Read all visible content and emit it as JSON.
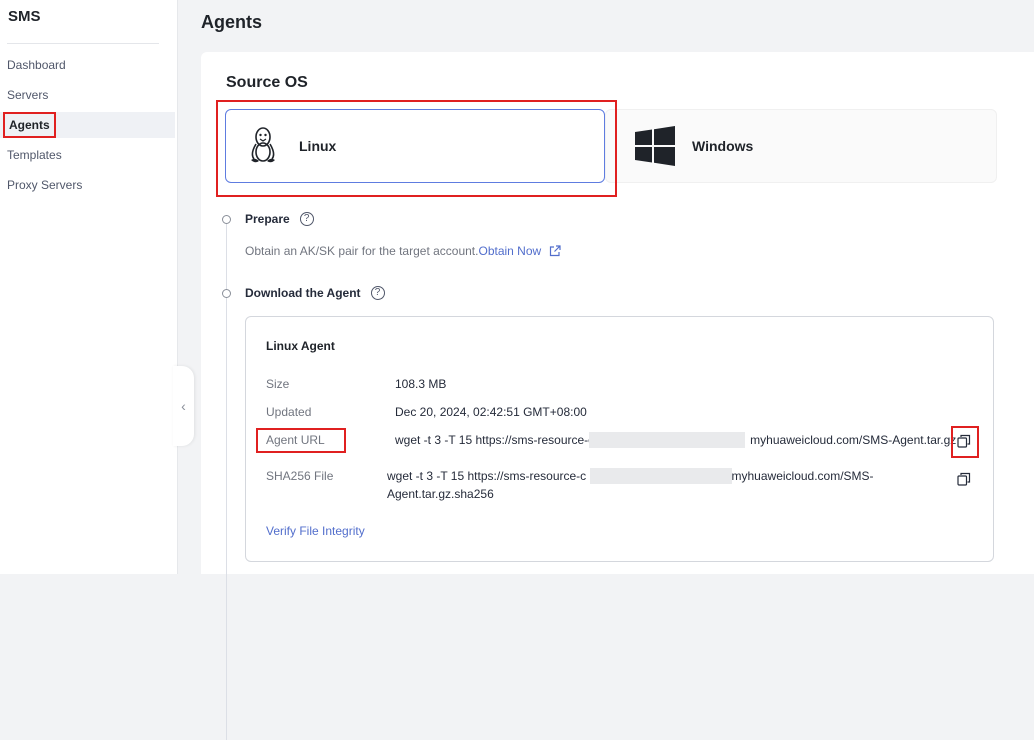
{
  "sidebar": {
    "brand": "SMS",
    "items": [
      {
        "label": "Dashboard"
      },
      {
        "label": "Servers"
      },
      {
        "label": "Agents"
      },
      {
        "label": "Templates"
      },
      {
        "label": "Proxy Servers"
      }
    ],
    "collapse_icon": "chevron-left-icon"
  },
  "page": {
    "title": "Agents"
  },
  "source_os": {
    "title": "Source OS",
    "options": [
      {
        "label": "Linux",
        "icon": "linux-tux-icon",
        "selected": true
      },
      {
        "label": "Windows",
        "icon": "windows-logo-icon",
        "selected": false
      }
    ]
  },
  "steps": {
    "prepare": {
      "title": "Prepare",
      "desc": "Obtain an AK/SK pair for the target account.",
      "link": "Obtain Now"
    },
    "download": {
      "title": "Download the Agent"
    }
  },
  "agent": {
    "title": "Linux Agent",
    "size_label": "Size",
    "size_value": "108.3 MB",
    "updated_label": "Updated",
    "updated_value": "Dec 20, 2024, 02:42:51 GMT+08:00",
    "url_label": "Agent URL",
    "url_prefix": "wget -t 3 -T 15 https://sms-resource-c",
    "url_suffix": "myhuaweicloud.com/SMS-Agent.tar.gz",
    "sha_label": "SHA256 File",
    "sha_line1_prefix": "wget -t 3 -T 15 https://sms-resource-c",
    "sha_line1_suffix": ".myhuaweicloud.com/SMS-",
    "sha_line2": "Agent.tar.gz.sha256",
    "verify_link": "Verify File Integrity"
  },
  "colors": {
    "accent": "#5e7ce0",
    "link": "#526ecc",
    "highlight": "#e02020"
  }
}
